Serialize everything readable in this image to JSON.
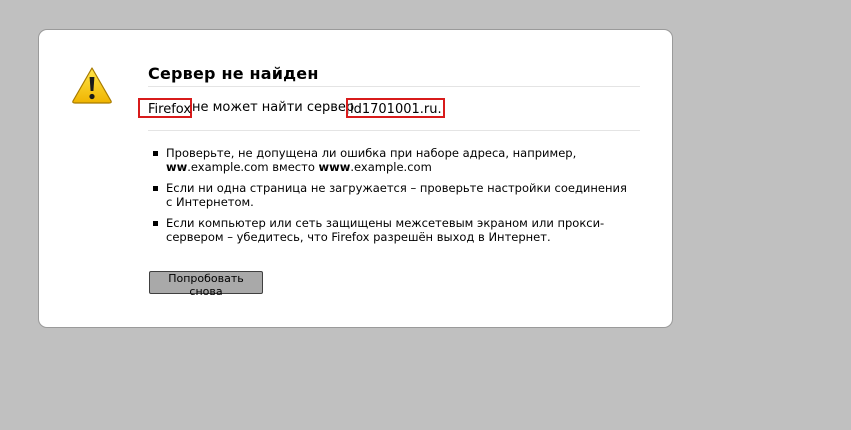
{
  "error": {
    "title": "Сервер не найден",
    "message": {
      "app": "Firefox",
      "middle": " не может найти сервер ",
      "host": "id1701001.ru."
    },
    "tips": [
      {
        "line1": "Проверьте, не допущена ли ошибка при наборе адреса, например,",
        "bad_prefix": "ww",
        "bad_rest": ".example.com",
        "instead": " вместо ",
        "good_prefix": "www",
        "good_rest": ".example.com"
      },
      {
        "text": "Если ни одна страница не загружается – проверьте настройки соединения с Интернетом."
      },
      {
        "text": "Если компьютер или сеть защищены межсетевым экраном или прокси-сервером – убедитесь, что Firefox разрешён выход в Интернет."
      }
    ],
    "retry_label": "Попробовать снова"
  },
  "colors": {
    "background": "#c0c0c0",
    "highlight": "#d81b1b",
    "button": "#a9a9a9"
  },
  "icons": {
    "warning": "warning-icon"
  }
}
